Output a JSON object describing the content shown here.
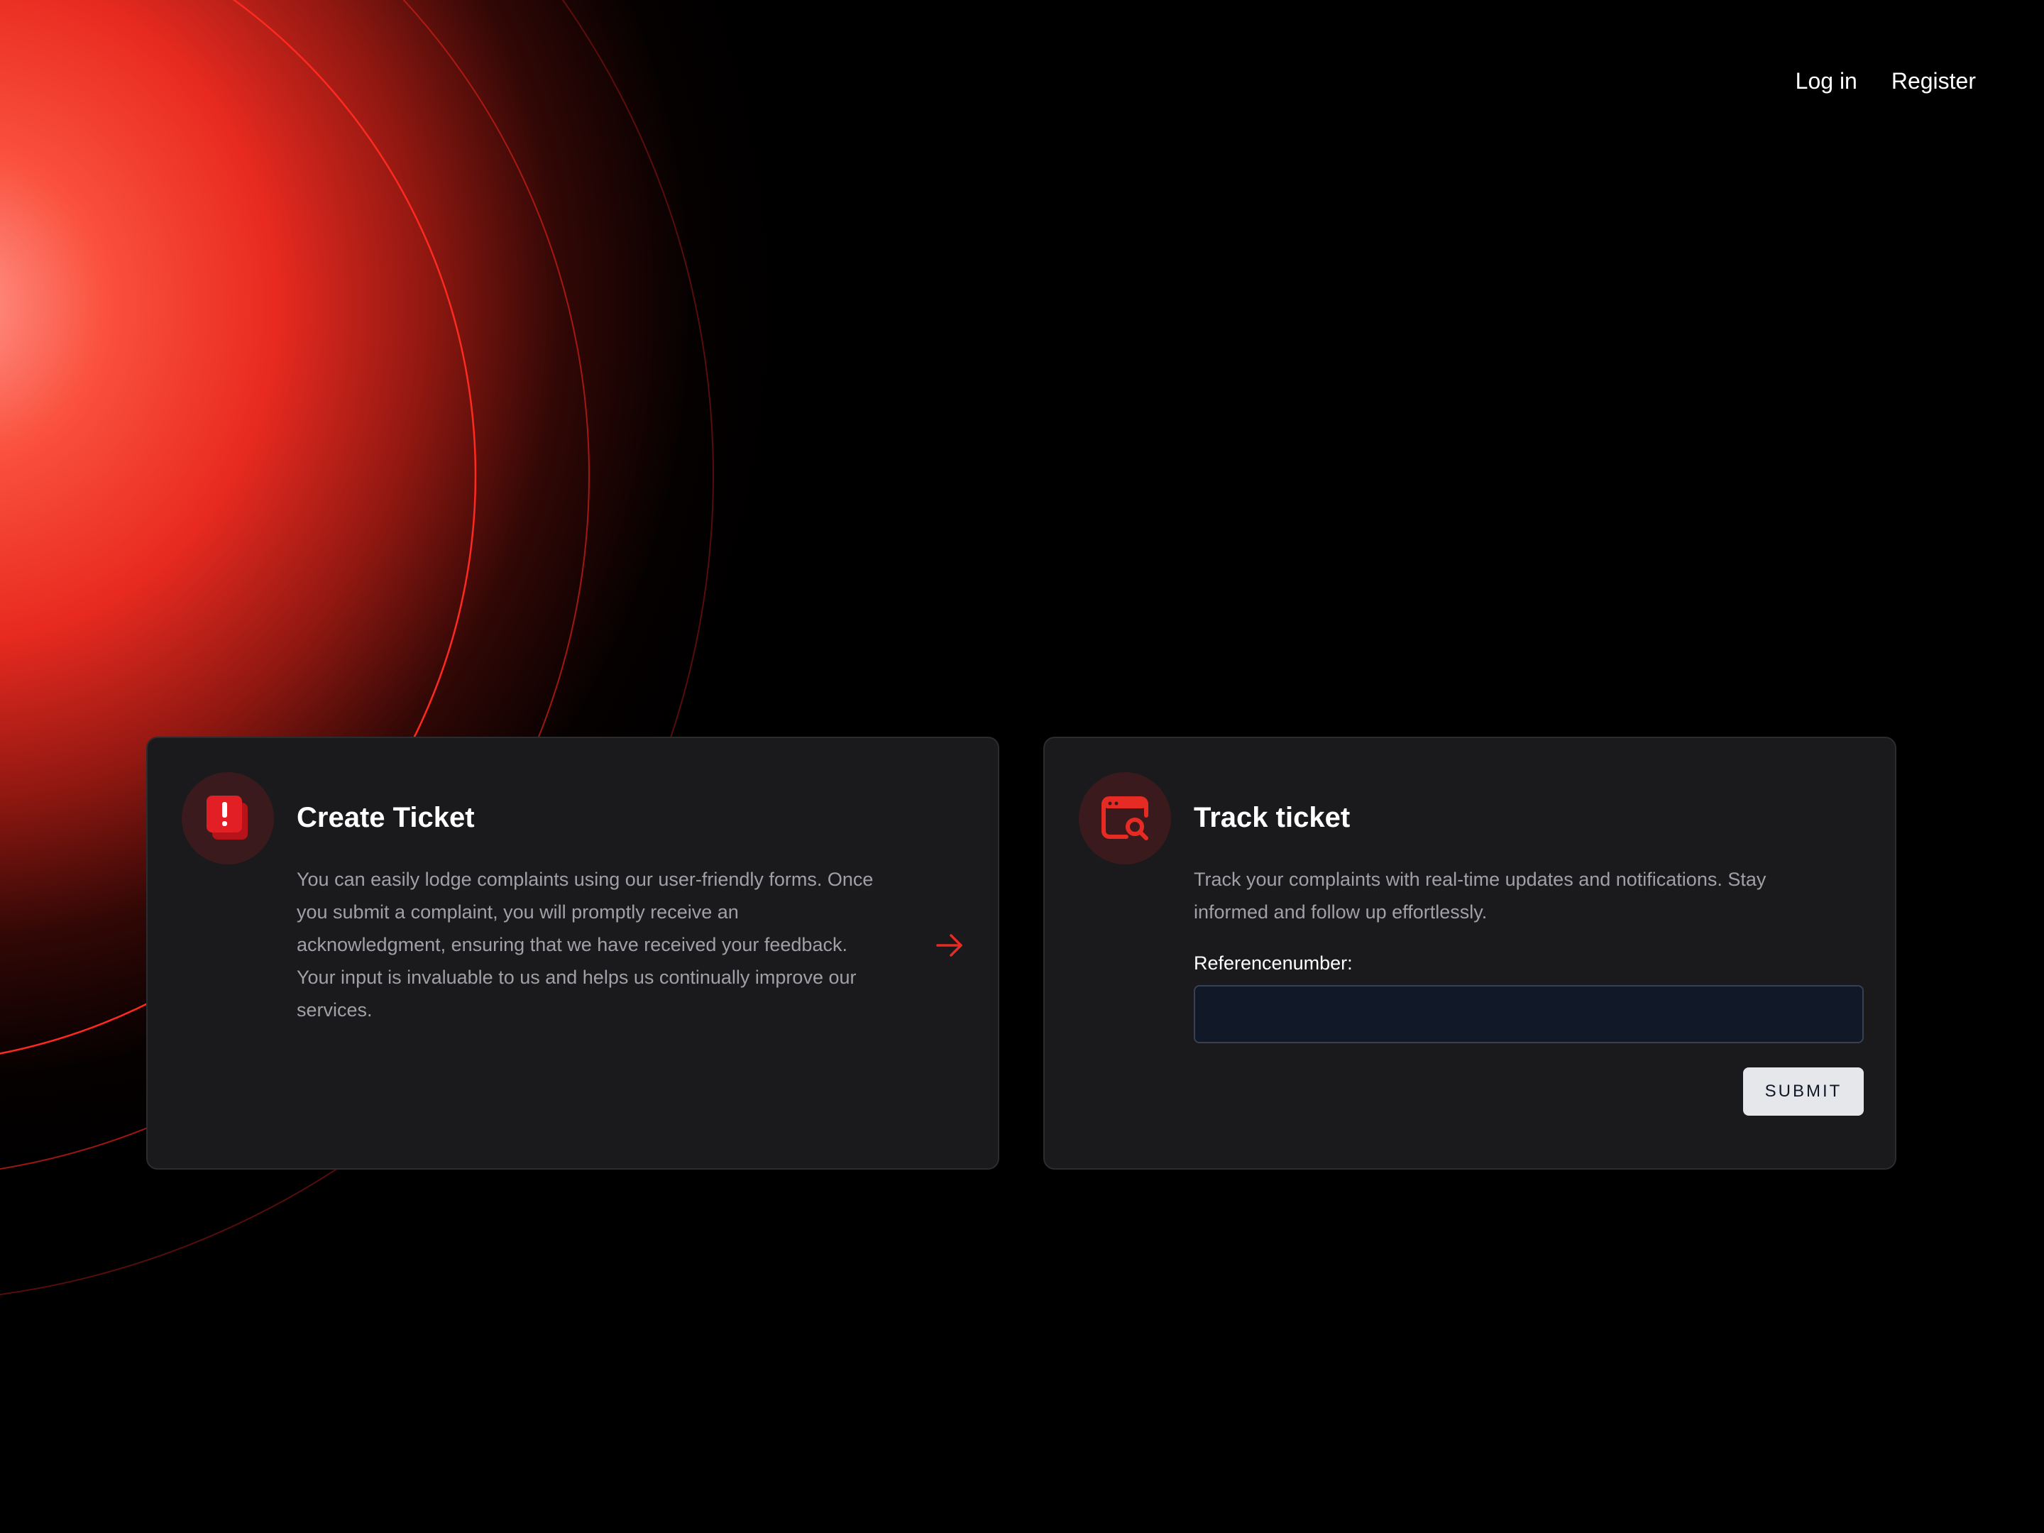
{
  "nav": {
    "login_label": "Log in",
    "register_label": "Register"
  },
  "create_ticket": {
    "title": "Create Ticket",
    "description": "You can easily lodge complaints using our user-friendly forms. Once you submit a complaint, you will promptly receive an acknowledgment, ensuring that we have received your feedback. Your input is invaluable to us and helps us continually improve our services.",
    "icon": "alert-document-icon",
    "action_icon": "arrow-right-icon"
  },
  "track_ticket": {
    "title": "Track ticket",
    "description": "Track your complaints with real-time updates and notifications. Stay informed and follow up effortlessly.",
    "icon": "browser-search-icon",
    "field_label": "Referencenumber:",
    "field_value": "",
    "submit_label": "SUBMIT"
  },
  "colors": {
    "accent": "#e52b24",
    "background": "#000000",
    "card": "#1a1a1c",
    "muted_text": "#a0a0a6"
  }
}
